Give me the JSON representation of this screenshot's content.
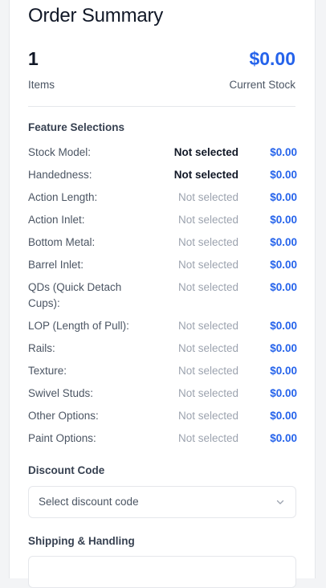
{
  "summary": {
    "title": "Order Summary",
    "item_count": "1",
    "item_count_label": "Items",
    "current_stock_price": "$0.00",
    "current_stock_label": "Current Stock"
  },
  "features": {
    "heading": "Feature Selections",
    "items": [
      {
        "label": "Stock Model:",
        "value": "Not selected",
        "price": "$0.00",
        "emphasis": true
      },
      {
        "label": "Handedness:",
        "value": "Not selected",
        "price": "$0.00",
        "emphasis": true
      },
      {
        "label": "Action Length:",
        "value": "Not selected",
        "price": "$0.00",
        "emphasis": false
      },
      {
        "label": "Action Inlet:",
        "value": "Not selected",
        "price": "$0.00",
        "emphasis": false
      },
      {
        "label": "Bottom Metal:",
        "value": "Not selected",
        "price": "$0.00",
        "emphasis": false
      },
      {
        "label": "Barrel Inlet:",
        "value": "Not selected",
        "price": "$0.00",
        "emphasis": false
      },
      {
        "label": "QDs (Quick Detach Cups):",
        "value": "Not selected",
        "price": "$0.00",
        "emphasis": false
      },
      {
        "label": "LOP (Length of Pull):",
        "value": "Not selected",
        "price": "$0.00",
        "emphasis": false
      },
      {
        "label": "Rails:",
        "value": "Not selected",
        "price": "$0.00",
        "emphasis": false
      },
      {
        "label": "Texture:",
        "value": "Not selected",
        "price": "$0.00",
        "emphasis": false
      },
      {
        "label": "Swivel Studs:",
        "value": "Not selected",
        "price": "$0.00",
        "emphasis": false
      },
      {
        "label": "Other Options:",
        "value": "Not selected",
        "price": "$0.00",
        "emphasis": false
      },
      {
        "label": "Paint Options:",
        "value": "Not selected",
        "price": "$0.00",
        "emphasis": false
      }
    ]
  },
  "discount": {
    "heading": "Discount Code",
    "placeholder": "Select discount code",
    "icon": "chevron-down-icon"
  },
  "shipping": {
    "heading": "Shipping & Handling"
  },
  "colors": {
    "accent": "#2563eb",
    "text_primary": "#111827",
    "text_muted": "#4b5563",
    "text_placeholder": "#9ca3af",
    "border": "#e5e7eb"
  }
}
